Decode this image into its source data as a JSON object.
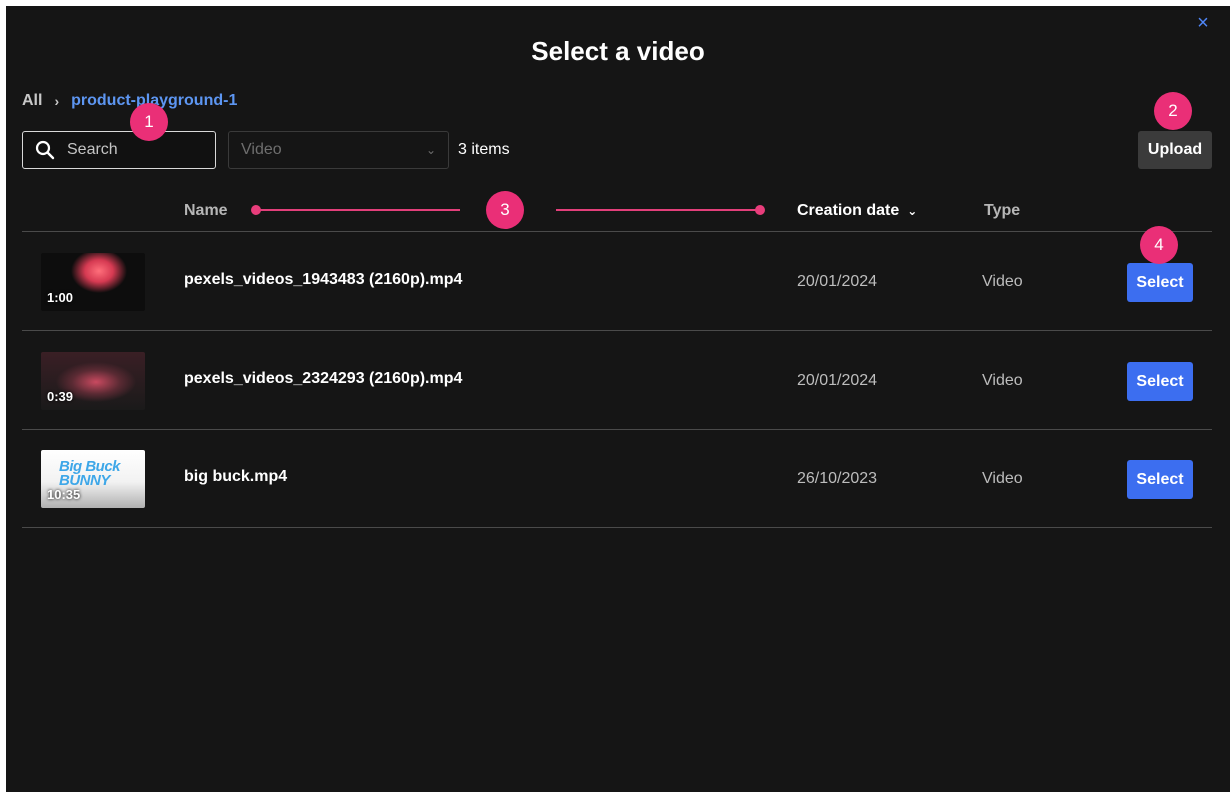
{
  "dialog": {
    "title": "Select a video",
    "close_label": "×"
  },
  "breadcrumb": {
    "root": "All",
    "separator": "›",
    "current": "product-playground-1"
  },
  "toolbar": {
    "search_placeholder": "Search",
    "type_filter_value": "Video",
    "item_count": "3 items",
    "upload_label": "Upload"
  },
  "table": {
    "columns": {
      "name": "Name",
      "creation_date": "Creation date",
      "type": "Type"
    },
    "rows": [
      {
        "duration": "1:00",
        "name": "pexels_videos_1943483 (2160p).mp4",
        "date": "20/01/2024",
        "type": "Video",
        "action": "Select"
      },
      {
        "duration": "0:39",
        "name": "pexels_videos_2324293 (2160p).mp4",
        "date": "20/01/2024",
        "type": "Video",
        "action": "Select"
      },
      {
        "duration": "10:35",
        "name": "big buck.mp4",
        "date": "26/10/2023",
        "type": "Video",
        "action": "Select",
        "thumb_logo": "Big Buck BUNNY"
      }
    ]
  },
  "callouts": [
    "1",
    "2",
    "3",
    "4"
  ],
  "colors": {
    "background": "#151515",
    "accent_blue": "#3c6ef0",
    "link_blue": "#5d96f2",
    "callout_pink": "#ea2f77",
    "upload_button": "#3b3b3b"
  },
  "icons": {
    "search": "search-icon",
    "close": "close-icon",
    "breadcrumb_separator": "chevron-right-icon",
    "dropdown": "chevron-down-icon",
    "sort": "chevron-down-icon"
  }
}
